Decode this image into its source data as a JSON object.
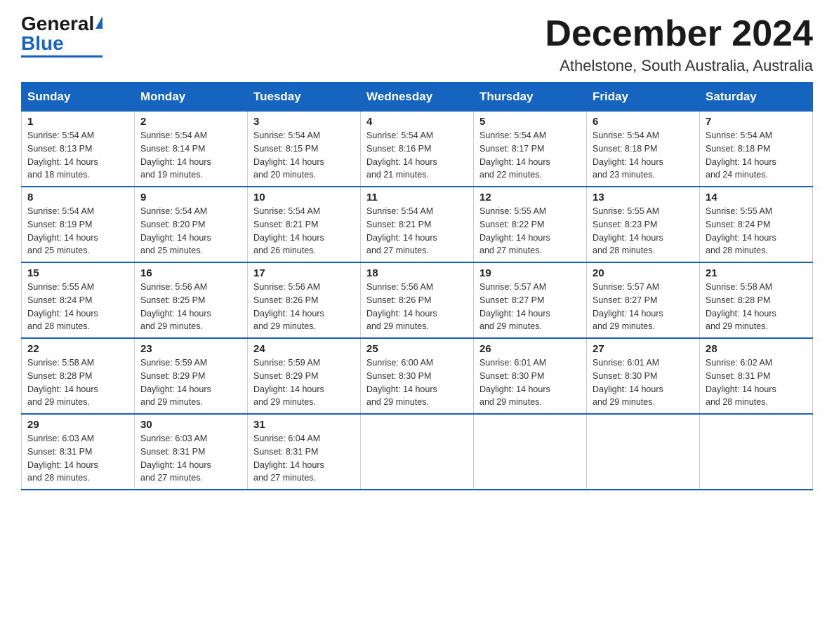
{
  "header": {
    "logo": {
      "general": "General",
      "blue": "Blue"
    },
    "month_title": "December 2024",
    "location": "Athelstone, South Australia, Australia"
  },
  "days_of_week": [
    "Sunday",
    "Monday",
    "Tuesday",
    "Wednesday",
    "Thursday",
    "Friday",
    "Saturday"
  ],
  "weeks": [
    [
      {
        "day": "1",
        "sunrise": "5:54 AM",
        "sunset": "8:13 PM",
        "daylight": "14 hours and 18 minutes."
      },
      {
        "day": "2",
        "sunrise": "5:54 AM",
        "sunset": "8:14 PM",
        "daylight": "14 hours and 19 minutes."
      },
      {
        "day": "3",
        "sunrise": "5:54 AM",
        "sunset": "8:15 PM",
        "daylight": "14 hours and 20 minutes."
      },
      {
        "day": "4",
        "sunrise": "5:54 AM",
        "sunset": "8:16 PM",
        "daylight": "14 hours and 21 minutes."
      },
      {
        "day": "5",
        "sunrise": "5:54 AM",
        "sunset": "8:17 PM",
        "daylight": "14 hours and 22 minutes."
      },
      {
        "day": "6",
        "sunrise": "5:54 AM",
        "sunset": "8:18 PM",
        "daylight": "14 hours and 23 minutes."
      },
      {
        "day": "7",
        "sunrise": "5:54 AM",
        "sunset": "8:18 PM",
        "daylight": "14 hours and 24 minutes."
      }
    ],
    [
      {
        "day": "8",
        "sunrise": "5:54 AM",
        "sunset": "8:19 PM",
        "daylight": "14 hours and 25 minutes."
      },
      {
        "day": "9",
        "sunrise": "5:54 AM",
        "sunset": "8:20 PM",
        "daylight": "14 hours and 25 minutes."
      },
      {
        "day": "10",
        "sunrise": "5:54 AM",
        "sunset": "8:21 PM",
        "daylight": "14 hours and 26 minutes."
      },
      {
        "day": "11",
        "sunrise": "5:54 AM",
        "sunset": "8:21 PM",
        "daylight": "14 hours and 27 minutes."
      },
      {
        "day": "12",
        "sunrise": "5:55 AM",
        "sunset": "8:22 PM",
        "daylight": "14 hours and 27 minutes."
      },
      {
        "day": "13",
        "sunrise": "5:55 AM",
        "sunset": "8:23 PM",
        "daylight": "14 hours and 28 minutes."
      },
      {
        "day": "14",
        "sunrise": "5:55 AM",
        "sunset": "8:24 PM",
        "daylight": "14 hours and 28 minutes."
      }
    ],
    [
      {
        "day": "15",
        "sunrise": "5:55 AM",
        "sunset": "8:24 PM",
        "daylight": "14 hours and 28 minutes."
      },
      {
        "day": "16",
        "sunrise": "5:56 AM",
        "sunset": "8:25 PM",
        "daylight": "14 hours and 29 minutes."
      },
      {
        "day": "17",
        "sunrise": "5:56 AM",
        "sunset": "8:26 PM",
        "daylight": "14 hours and 29 minutes."
      },
      {
        "day": "18",
        "sunrise": "5:56 AM",
        "sunset": "8:26 PM",
        "daylight": "14 hours and 29 minutes."
      },
      {
        "day": "19",
        "sunrise": "5:57 AM",
        "sunset": "8:27 PM",
        "daylight": "14 hours and 29 minutes."
      },
      {
        "day": "20",
        "sunrise": "5:57 AM",
        "sunset": "8:27 PM",
        "daylight": "14 hours and 29 minutes."
      },
      {
        "day": "21",
        "sunrise": "5:58 AM",
        "sunset": "8:28 PM",
        "daylight": "14 hours and 29 minutes."
      }
    ],
    [
      {
        "day": "22",
        "sunrise": "5:58 AM",
        "sunset": "8:28 PM",
        "daylight": "14 hours and 29 minutes."
      },
      {
        "day": "23",
        "sunrise": "5:59 AM",
        "sunset": "8:29 PM",
        "daylight": "14 hours and 29 minutes."
      },
      {
        "day": "24",
        "sunrise": "5:59 AM",
        "sunset": "8:29 PM",
        "daylight": "14 hours and 29 minutes."
      },
      {
        "day": "25",
        "sunrise": "6:00 AM",
        "sunset": "8:30 PM",
        "daylight": "14 hours and 29 minutes."
      },
      {
        "day": "26",
        "sunrise": "6:01 AM",
        "sunset": "8:30 PM",
        "daylight": "14 hours and 29 minutes."
      },
      {
        "day": "27",
        "sunrise": "6:01 AM",
        "sunset": "8:30 PM",
        "daylight": "14 hours and 29 minutes."
      },
      {
        "day": "28",
        "sunrise": "6:02 AM",
        "sunset": "8:31 PM",
        "daylight": "14 hours and 28 minutes."
      }
    ],
    [
      {
        "day": "29",
        "sunrise": "6:03 AM",
        "sunset": "8:31 PM",
        "daylight": "14 hours and 28 minutes."
      },
      {
        "day": "30",
        "sunrise": "6:03 AM",
        "sunset": "8:31 PM",
        "daylight": "14 hours and 27 minutes."
      },
      {
        "day": "31",
        "sunrise": "6:04 AM",
        "sunset": "8:31 PM",
        "daylight": "14 hours and 27 minutes."
      },
      null,
      null,
      null,
      null
    ]
  ],
  "labels": {
    "sunrise": "Sunrise:",
    "sunset": "Sunset:",
    "daylight": "Daylight:"
  }
}
